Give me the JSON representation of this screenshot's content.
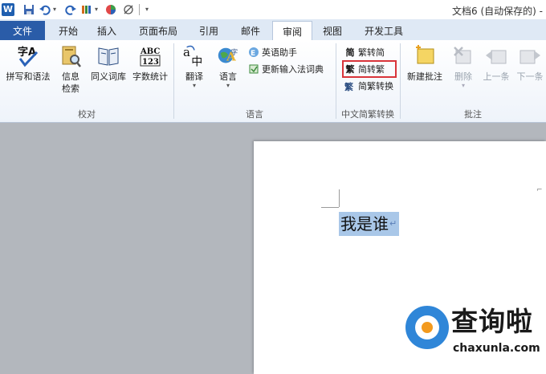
{
  "title_bar": {
    "app_logo": "W",
    "doc_title": "文档6 (自动保存的) -"
  },
  "tabs": [
    {
      "label": "文件"
    },
    {
      "label": "开始"
    },
    {
      "label": "插入"
    },
    {
      "label": "页面布局"
    },
    {
      "label": "引用"
    },
    {
      "label": "邮件"
    },
    {
      "label": "审阅"
    },
    {
      "label": "视图"
    },
    {
      "label": "开发工具"
    }
  ],
  "active_tab": "审阅",
  "ribbon": {
    "proofing": {
      "group_label": "校对",
      "spelling": "拼写和语法",
      "research_line1": "信息",
      "research_line2": "检索",
      "thesaurus": "同义词库",
      "word_count": "字数统计",
      "word_count_icon_text": "ABC\n123"
    },
    "language": {
      "group_label": "语言",
      "translate": "翻译",
      "language": "语言",
      "english_assistant": "英语助手",
      "update_ime": "更新输入法词典"
    },
    "chinese_conversion": {
      "group_label": "中文简繁转换",
      "trad_to_simp": "繁转简",
      "simp_to_trad": "简转繁",
      "convert": "简繁转换",
      "icon_trad": "繁",
      "icon_simp": "简"
    },
    "comments": {
      "group_label": "批注",
      "new_comment": "新建批注",
      "delete": "删除",
      "previous": "上一条",
      "next": "下一条"
    }
  },
  "document": {
    "selected_text": "我是谁",
    "paragraph_mark": "↵"
  },
  "watermark": {
    "title": "查询啦",
    "subtitle": "chaxunla.com"
  },
  "colors": {
    "file_tab": "#2a5ca8",
    "highlight_box": "#d9343a",
    "selection": "#a9c7e8",
    "watermark_blue": "#2f86d8",
    "watermark_orange": "#f39a1e"
  }
}
